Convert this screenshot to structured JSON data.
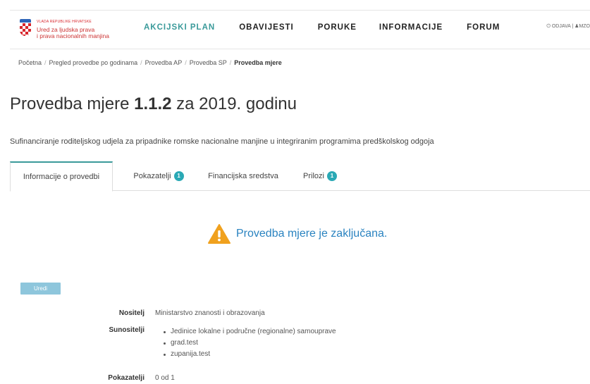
{
  "header": {
    "logo": {
      "line_small": "VLADA REPUBLIKE HRVATSKE",
      "line1": "Ured za ljudska prava",
      "line2": "i prava nacionalnih manjina"
    },
    "nav": [
      {
        "label": "AKCIJSKI PLAN",
        "active": true
      },
      {
        "label": "OBAVIJESTI",
        "active": false
      },
      {
        "label": "PORUKE",
        "active": false
      },
      {
        "label": "INFORMACIJE",
        "active": false
      },
      {
        "label": "FORUM",
        "active": false
      }
    ],
    "top_right": {
      "logout": "ODJAVA",
      "separator": "|",
      "user": "MZO"
    },
    "accent_color": "#3a9a9a"
  },
  "breadcrumb": [
    "Početna",
    "Pregled provedbe po godinama",
    "Provedba AP",
    "Provedba SP",
    "Provedba mjere"
  ],
  "page": {
    "title_prefix": "Provedba mjere ",
    "title_code": "1.1.2",
    "title_suffix": " za 2019. godinu",
    "subtitle": "Sufinanciranje roditeljskog udjela za pripadnike romske nacionalne manjine u integriranim programima predškolskog odgoja"
  },
  "tabs": [
    {
      "label": "Informacije o provedbi",
      "badge": "",
      "active": true
    },
    {
      "label": "Pokazatelji",
      "badge": "1",
      "active": false
    },
    {
      "label": "Financijska sredstva",
      "badge": "",
      "active": false
    },
    {
      "label": "Prilozi",
      "badge": "1",
      "active": false
    }
  ],
  "status": {
    "icon": "warning-icon",
    "text": "Provedba mjere je zaključana.",
    "color": "#2a83c0"
  },
  "edit_button": "Uredi",
  "details": {
    "nositelj_label": "Nositelj",
    "nositelj_value": "Ministarstvo znanosti i obrazovanja",
    "sunositelji_label": "Sunositelji",
    "sunositelji": [
      "Jedinice lokalne i područne (regionalne) samouprave",
      "grad.test",
      "zupanija.test"
    ],
    "pokazatelji_label": "Pokazatelji",
    "pokazatelji_value": "0 od 1"
  }
}
